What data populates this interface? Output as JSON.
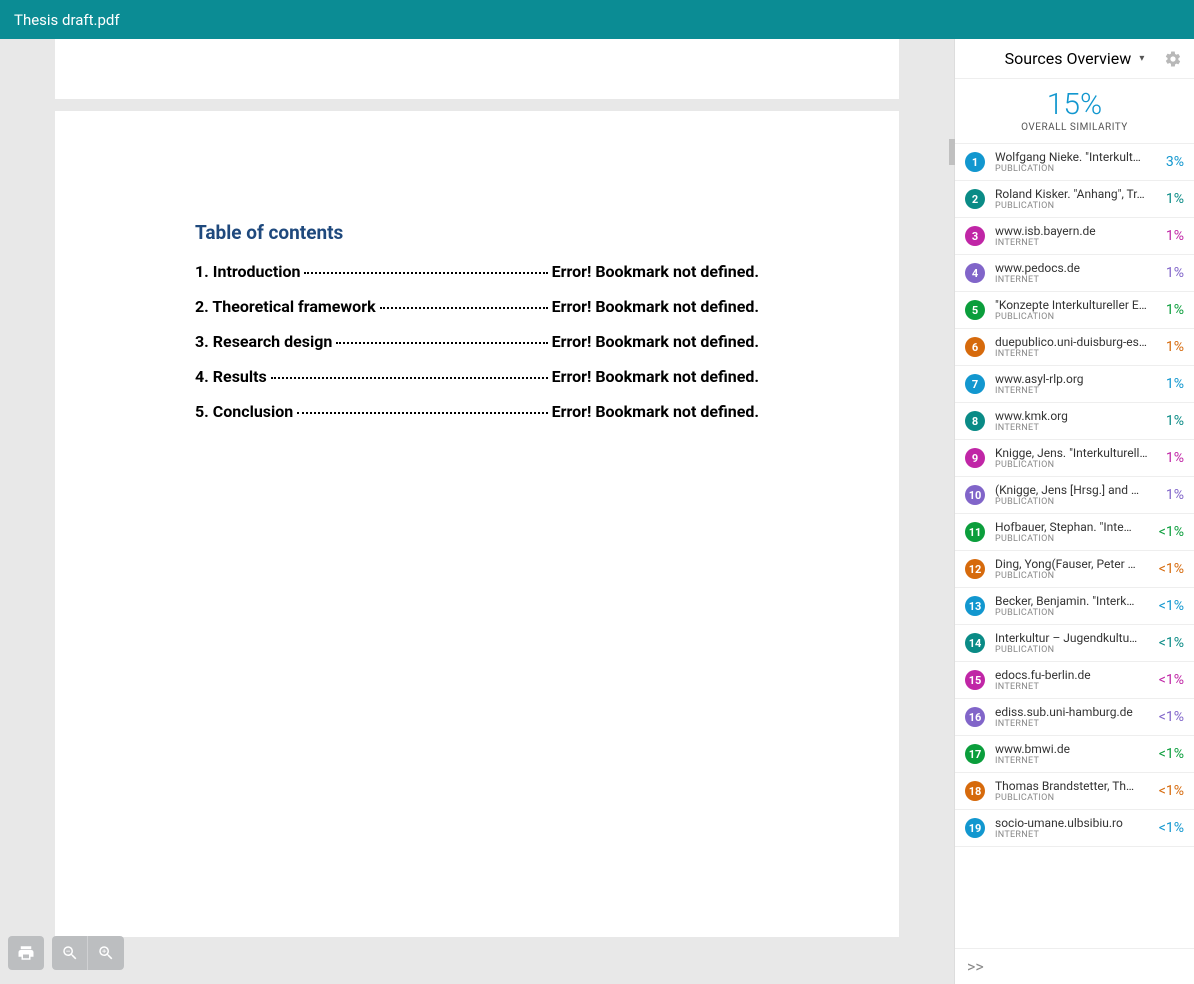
{
  "header": {
    "title": "Thesis draft.pdf"
  },
  "doc": {
    "toc_title": "Table of contents",
    "items": [
      {
        "label": "1. Introduction",
        "err": "Error! Bookmark not defined."
      },
      {
        "label": "2. Theoretical framework",
        "err": "Error! Bookmark not defined."
      },
      {
        "label": "3. Research design",
        "err": "Error! Bookmark not defined."
      },
      {
        "label": "4. Results",
        "err": "Error! Bookmark not defined."
      },
      {
        "label": "5. Conclusion",
        "err": "Error! Bookmark not defined."
      }
    ]
  },
  "sidebar": {
    "head": "Sources Overview",
    "overall_pct": "15%",
    "overall_label": "OVERALL SIMILARITY",
    "more": ">>",
    "sources": [
      {
        "n": "1",
        "title": "Wolfgang Nieke. \"Interkult…",
        "type": "PUBLICATION",
        "pct": "3%",
        "badge": "#1297cf",
        "pctColor": "#1297cf"
      },
      {
        "n": "2",
        "title": "Roland Kisker. \"Anhang\", Tr…",
        "type": "PUBLICATION",
        "pct": "1%",
        "badge": "#0a8b86",
        "pctColor": "#0a8b86"
      },
      {
        "n": "3",
        "title": "www.isb.bayern.de",
        "type": "INTERNET",
        "pct": "1%",
        "badge": "#c026a6",
        "pctColor": "#c026a6"
      },
      {
        "n": "4",
        "title": "www.pedocs.de",
        "type": "INTERNET",
        "pct": "1%",
        "badge": "#8165c9",
        "pctColor": "#8165c9"
      },
      {
        "n": "5",
        "title": "\"Konzepte Interkultureller E…",
        "type": "PUBLICATION",
        "pct": "1%",
        "badge": "#0b9e3c",
        "pctColor": "#0b9e3c"
      },
      {
        "n": "6",
        "title": "duepublico.uni-duisburg-es…",
        "type": "INTERNET",
        "pct": "1%",
        "badge": "#d66a0c",
        "pctColor": "#d66a0c"
      },
      {
        "n": "7",
        "title": "www.asyl-rlp.org",
        "type": "INTERNET",
        "pct": "1%",
        "badge": "#1297cf",
        "pctColor": "#1297cf"
      },
      {
        "n": "8",
        "title": "www.kmk.org",
        "type": "INTERNET",
        "pct": "1%",
        "badge": "#0a8b86",
        "pctColor": "#0a8b86"
      },
      {
        "n": "9",
        "title": "Knigge, Jens. \"Interkulturell…",
        "type": "PUBLICATION",
        "pct": "1%",
        "badge": "#c026a6",
        "pctColor": "#c026a6"
      },
      {
        "n": "10",
        "title": "(Knigge, Jens [Hrsg.] and …",
        "type": "PUBLICATION",
        "pct": "1%",
        "badge": "#8165c9",
        "pctColor": "#8165c9"
      },
      {
        "n": "11",
        "title": "Hofbauer, Stephan. \"Inte…",
        "type": "PUBLICATION",
        "pct": "<1%",
        "badge": "#0b9e3c",
        "pctColor": "#0b9e3c"
      },
      {
        "n": "12",
        "title": "Ding, Yong(Fauser, Peter …",
        "type": "PUBLICATION",
        "pct": "<1%",
        "badge": "#d66a0c",
        "pctColor": "#d66a0c"
      },
      {
        "n": "13",
        "title": "Becker, Benjamin. \"Interk…",
        "type": "PUBLICATION",
        "pct": "<1%",
        "badge": "#1297cf",
        "pctColor": "#1297cf"
      },
      {
        "n": "14",
        "title": "Interkultur – Jugendkultu…",
        "type": "PUBLICATION",
        "pct": "<1%",
        "badge": "#0a8b86",
        "pctColor": "#0a8b86"
      },
      {
        "n": "15",
        "title": "edocs.fu-berlin.de",
        "type": "INTERNET",
        "pct": "<1%",
        "badge": "#c026a6",
        "pctColor": "#c026a6"
      },
      {
        "n": "16",
        "title": "ediss.sub.uni-hamburg.de",
        "type": "INTERNET",
        "pct": "<1%",
        "badge": "#8165c9",
        "pctColor": "#8165c9"
      },
      {
        "n": "17",
        "title": "www.bmwi.de",
        "type": "INTERNET",
        "pct": "<1%",
        "badge": "#0b9e3c",
        "pctColor": "#0b9e3c"
      },
      {
        "n": "18",
        "title": "Thomas Brandstetter, Th…",
        "type": "PUBLICATION",
        "pct": "<1%",
        "badge": "#d66a0c",
        "pctColor": "#d66a0c"
      },
      {
        "n": "19",
        "title": "socio-umane.ulbsibiu.ro",
        "type": "INTERNET",
        "pct": "<1%",
        "badge": "#1297cf",
        "pctColor": "#1297cf"
      }
    ]
  }
}
